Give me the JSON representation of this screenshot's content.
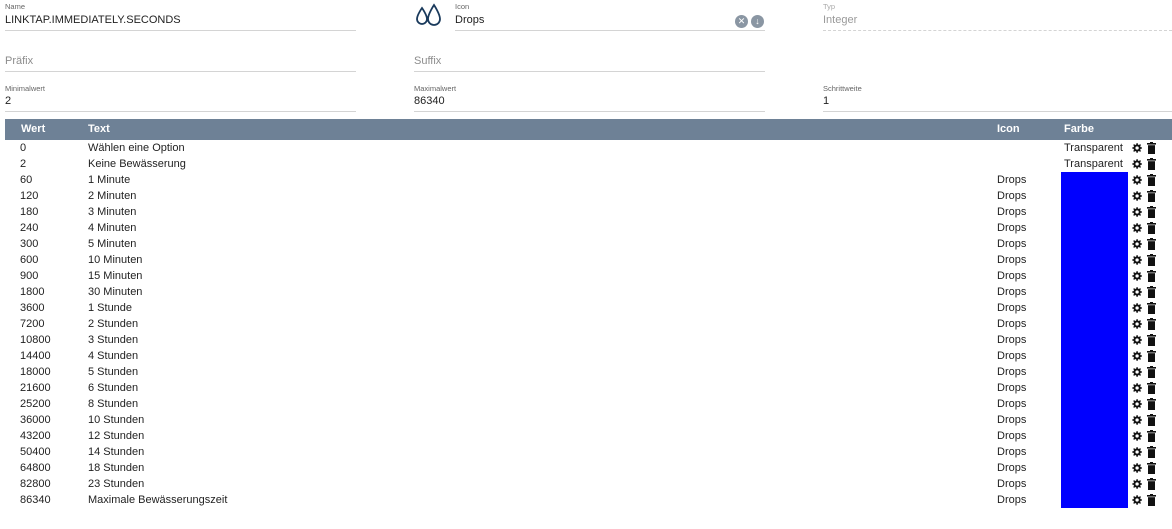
{
  "form": {
    "name": {
      "label": "Name",
      "value": "LINKTAP.IMMEDIATELY.SECONDS"
    },
    "icon": {
      "label": "Icon",
      "value": "Drops",
      "icon": "drops-icon"
    },
    "typ": {
      "label": "Typ",
      "value": "Integer"
    },
    "prefix": {
      "placeholder": "Präfix"
    },
    "suffix": {
      "placeholder": "Suffix"
    },
    "min": {
      "label": "Minimalwert",
      "value": "2"
    },
    "max": {
      "label": "Maximalwert",
      "value": "86340"
    },
    "step": {
      "label": "Schrittweite",
      "value": "1"
    }
  },
  "table": {
    "headers": {
      "wert": "Wert",
      "text": "Text",
      "icon": "Icon",
      "farbe": "Farbe"
    },
    "colors": {
      "header_bg": "#6e8196",
      "blue": "#0000ff"
    },
    "rows": [
      {
        "wert": "0",
        "text": "Wählen eine Option",
        "icon": "",
        "farbe": "Transparent"
      },
      {
        "wert": "2",
        "text": "Keine Bewässerung",
        "icon": "",
        "farbe": "Transparent"
      },
      {
        "wert": "60",
        "text": "1 Minute",
        "icon": "Drops",
        "farbe": ""
      },
      {
        "wert": "120",
        "text": "2 Minuten",
        "icon": "Drops",
        "farbe": ""
      },
      {
        "wert": "180",
        "text": "3 Minuten",
        "icon": "Drops",
        "farbe": ""
      },
      {
        "wert": "240",
        "text": "4 Minuten",
        "icon": "Drops",
        "farbe": ""
      },
      {
        "wert": "300",
        "text": "5 Minuten",
        "icon": "Drops",
        "farbe": ""
      },
      {
        "wert": "600",
        "text": "10 Minuten",
        "icon": "Drops",
        "farbe": ""
      },
      {
        "wert": "900",
        "text": "15 Minuten",
        "icon": "Drops",
        "farbe": ""
      },
      {
        "wert": "1800",
        "text": "30 Minuten",
        "icon": "Drops",
        "farbe": ""
      },
      {
        "wert": "3600",
        "text": "1 Stunde",
        "icon": "Drops",
        "farbe": ""
      },
      {
        "wert": "7200",
        "text": "2 Stunden",
        "icon": "Drops",
        "farbe": ""
      },
      {
        "wert": "10800",
        "text": "3 Stunden",
        "icon": "Drops",
        "farbe": ""
      },
      {
        "wert": "14400",
        "text": "4 Stunden",
        "icon": "Drops",
        "farbe": ""
      },
      {
        "wert": "18000",
        "text": "5 Stunden",
        "icon": "Drops",
        "farbe": ""
      },
      {
        "wert": "21600",
        "text": "6 Stunden",
        "icon": "Drops",
        "farbe": ""
      },
      {
        "wert": "25200",
        "text": "8 Stunden",
        "icon": "Drops",
        "farbe": ""
      },
      {
        "wert": "36000",
        "text": "10 Stunden",
        "icon": "Drops",
        "farbe": ""
      },
      {
        "wert": "43200",
        "text": "12 Stunden",
        "icon": "Drops",
        "farbe": ""
      },
      {
        "wert": "50400",
        "text": "14 Stunden",
        "icon": "Drops",
        "farbe": ""
      },
      {
        "wert": "64800",
        "text": "18 Stunden",
        "icon": "Drops",
        "farbe": ""
      },
      {
        "wert": "82800",
        "text": "23 Stunden",
        "icon": "Drops",
        "farbe": ""
      },
      {
        "wert": "86340",
        "text": "Maximale Bewässerungszeit",
        "icon": "Drops",
        "farbe": ""
      }
    ]
  }
}
